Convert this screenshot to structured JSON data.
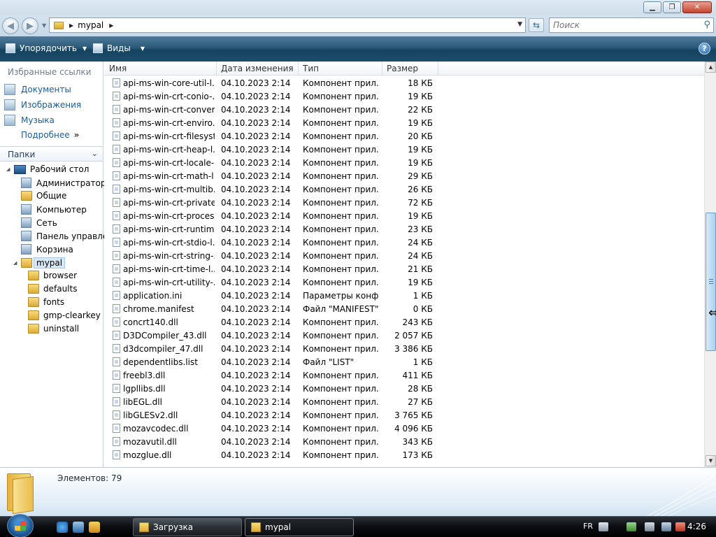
{
  "window": {
    "minimize_glyph": "▁",
    "maximize_glyph": "❐",
    "close_glyph": "✕"
  },
  "address": {
    "crumbs": [
      "mypal"
    ],
    "search_placeholder": "Поиск"
  },
  "toolbar": {
    "organize_label": "Упорядочить",
    "views_label": "Виды",
    "help_glyph": "?"
  },
  "favorites": {
    "header": "Избранные ссылки",
    "items": [
      {
        "label": "Документы",
        "icon": "documents-icon"
      },
      {
        "label": "Изображения",
        "icon": "pictures-icon"
      },
      {
        "label": "Музыка",
        "icon": "music-icon"
      }
    ],
    "more_label": "Подробнее",
    "more_glyph": "»"
  },
  "folders": {
    "header": "Папки",
    "tree": [
      {
        "label": "Рабочий стол",
        "icon": "desktop-icon",
        "level": 0,
        "expander": "◢"
      },
      {
        "label": "Администратор",
        "icon": "user-folder-icon",
        "level": 1
      },
      {
        "label": "Общие",
        "icon": "folder-icon",
        "level": 1
      },
      {
        "label": "Компьютер",
        "icon": "computer-icon",
        "level": 1
      },
      {
        "label": "Сеть",
        "icon": "network-icon",
        "level": 1
      },
      {
        "label": "Панель управлен",
        "icon": "control-panel-icon",
        "level": 1
      },
      {
        "label": "Корзина",
        "icon": "recycle-bin-icon",
        "level": 1
      },
      {
        "label": "mypal",
        "icon": "folder-icon",
        "level": 1,
        "expander": "◢",
        "selected": true
      },
      {
        "label": "browser",
        "icon": "folder-icon",
        "level": 2
      },
      {
        "label": "defaults",
        "icon": "folder-icon",
        "level": 2
      },
      {
        "label": "fonts",
        "icon": "folder-icon",
        "level": 2
      },
      {
        "label": "gmp-clearkey",
        "icon": "folder-icon",
        "level": 2
      },
      {
        "label": "uninstall",
        "icon": "folder-icon",
        "level": 2
      }
    ]
  },
  "columns": [
    "Имя",
    "Дата изменения",
    "Тип",
    "Размер"
  ],
  "files": [
    {
      "name": "api-ms-win-core-util-l...",
      "date": "04.10.2023 2:14",
      "type": "Компонент прил...",
      "size": "18 КБ"
    },
    {
      "name": "api-ms-win-crt-conio-...",
      "date": "04.10.2023 2:14",
      "type": "Компонент прил...",
      "size": "19 КБ"
    },
    {
      "name": "api-ms-win-crt-conver...",
      "date": "04.10.2023 2:14",
      "type": "Компонент прил...",
      "size": "22 КБ"
    },
    {
      "name": "api-ms-win-crt-enviro...",
      "date": "04.10.2023 2:14",
      "type": "Компонент прил...",
      "size": "19 КБ"
    },
    {
      "name": "api-ms-win-crt-filesyst...",
      "date": "04.10.2023 2:14",
      "type": "Компонент прил...",
      "size": "20 КБ"
    },
    {
      "name": "api-ms-win-crt-heap-l...",
      "date": "04.10.2023 2:14",
      "type": "Компонент прил...",
      "size": "19 КБ"
    },
    {
      "name": "api-ms-win-crt-locale-...",
      "date": "04.10.2023 2:14",
      "type": "Компонент прил...",
      "size": "19 КБ"
    },
    {
      "name": "api-ms-win-crt-math-l...",
      "date": "04.10.2023 2:14",
      "type": "Компонент прил...",
      "size": "29 КБ"
    },
    {
      "name": "api-ms-win-crt-multib...",
      "date": "04.10.2023 2:14",
      "type": "Компонент прил...",
      "size": "26 КБ"
    },
    {
      "name": "api-ms-win-crt-private...",
      "date": "04.10.2023 2:14",
      "type": "Компонент прил...",
      "size": "72 КБ"
    },
    {
      "name": "api-ms-win-crt-proces...",
      "date": "04.10.2023 2:14",
      "type": "Компонент прил...",
      "size": "19 КБ"
    },
    {
      "name": "api-ms-win-crt-runtim...",
      "date": "04.10.2023 2:14",
      "type": "Компонент прил...",
      "size": "23 КБ"
    },
    {
      "name": "api-ms-win-crt-stdio-l...",
      "date": "04.10.2023 2:14",
      "type": "Компонент прил...",
      "size": "24 КБ"
    },
    {
      "name": "api-ms-win-crt-string-...",
      "date": "04.10.2023 2:14",
      "type": "Компонент прил...",
      "size": "24 КБ"
    },
    {
      "name": "api-ms-win-crt-time-l...",
      "date": "04.10.2023 2:14",
      "type": "Компонент прил...",
      "size": "21 КБ"
    },
    {
      "name": "api-ms-win-crt-utility-...",
      "date": "04.10.2023 2:14",
      "type": "Компонент прил...",
      "size": "19 КБ"
    },
    {
      "name": "application.ini",
      "date": "04.10.2023 2:14",
      "type": "Параметры конф...",
      "size": "1 КБ"
    },
    {
      "name": "chrome.manifest",
      "date": "04.10.2023 2:14",
      "type": "Файл \"MANIFEST\"",
      "size": "0 КБ"
    },
    {
      "name": "concrt140.dll",
      "date": "04.10.2023 2:14",
      "type": "Компонент прил...",
      "size": "243 КБ"
    },
    {
      "name": "D3DCompiler_43.dll",
      "date": "04.10.2023 2:14",
      "type": "Компонент прил...",
      "size": "2 057 КБ"
    },
    {
      "name": "d3dcompiler_47.dll",
      "date": "04.10.2023 2:14",
      "type": "Компонент прил...",
      "size": "3 386 КБ"
    },
    {
      "name": "dependentlibs.list",
      "date": "04.10.2023 2:14",
      "type": "Файл \"LIST\"",
      "size": "1 КБ"
    },
    {
      "name": "freebl3.dll",
      "date": "04.10.2023 2:14",
      "type": "Компонент прил...",
      "size": "411 КБ"
    },
    {
      "name": "lgpllibs.dll",
      "date": "04.10.2023 2:14",
      "type": "Компонент прил...",
      "size": "28 КБ"
    },
    {
      "name": "libEGL.dll",
      "date": "04.10.2023 2:14",
      "type": "Компонент прил...",
      "size": "27 КБ"
    },
    {
      "name": "libGLESv2.dll",
      "date": "04.10.2023 2:14",
      "type": "Компонент прил...",
      "size": "3 765 КБ"
    },
    {
      "name": "mozavcodec.dll",
      "date": "04.10.2023 2:14",
      "type": "Компонент прил...",
      "size": "4 096 КБ"
    },
    {
      "name": "mozavutil.dll",
      "date": "04.10.2023 2:14",
      "type": "Компонент прил...",
      "size": "343 КБ"
    },
    {
      "name": "mozglue.dll",
      "date": "04.10.2023 2:14",
      "type": "Компонент прил...",
      "size": "173 КБ"
    }
  ],
  "status": {
    "items_count": "Элементов: 79"
  },
  "taskbar": {
    "tasks": [
      {
        "label": "Загрузка",
        "active": false
      },
      {
        "label": "mypal",
        "active": true
      }
    ],
    "language": "FR",
    "clock": "4:26"
  },
  "colors": {
    "link": "#1d5b96",
    "toolbar": "#1d4e6c"
  }
}
